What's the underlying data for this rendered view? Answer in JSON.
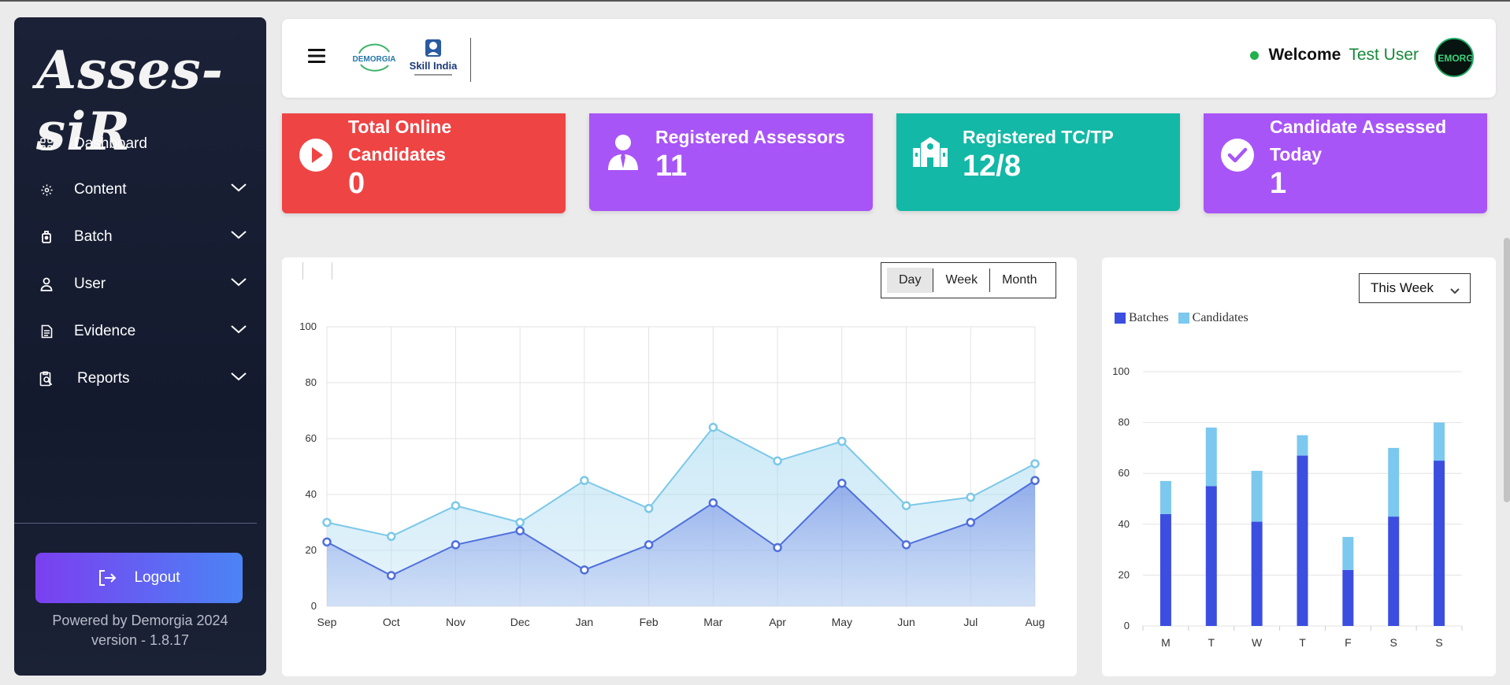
{
  "sidebar": {
    "logo_text": "Asses-siR",
    "items": [
      {
        "label": "Dashboard",
        "icon": "grid-icon"
      },
      {
        "label": "Content",
        "icon": "gear-icon"
      },
      {
        "label": "Batch",
        "icon": "batch-icon"
      },
      {
        "label": "User",
        "icon": "user-icon"
      },
      {
        "label": "Evidence",
        "icon": "document-icon"
      },
      {
        "label": "Reports",
        "icon": "report-icon"
      }
    ],
    "logout_label": "Logout",
    "powered_by": "Powered by Demorgia 2024",
    "version": "version - 1.8.17"
  },
  "header": {
    "demorgia_logo": "DEMORGIA",
    "skill_india_logo": "Skill India",
    "welcome_label": "Welcome",
    "user_name": "Test User",
    "avatar_text": "EMORG"
  },
  "stats": [
    {
      "title_line1": "Total Online",
      "title_line2": "Candidates",
      "value": "0",
      "color": "#ef4444",
      "icon": "play-circle-icon"
    },
    {
      "title_line1": "Registered Assessors",
      "title_line2": "",
      "value": "11",
      "color": "#a855f7",
      "icon": "assessor-icon"
    },
    {
      "title_line1": "Registered TC/TP",
      "title_line2": "",
      "value": "12/8",
      "color": "#14b8a6",
      "icon": "school-icon"
    },
    {
      "title_line1": "Candidate Assessed",
      "title_line2": "Today",
      "value": "1",
      "color": "#a855f7",
      "icon": "check-circle-icon"
    }
  ],
  "line_panel": {
    "ranges": [
      "Day",
      "Week",
      "Month"
    ],
    "active_range": "Day"
  },
  "bar_panel": {
    "select_value": "This Week"
  },
  "chart_data": [
    {
      "type": "area",
      "categories": [
        "Sep",
        "Oct",
        "Nov",
        "Dec",
        "Jan",
        "Feb",
        "Mar",
        "Apr",
        "May",
        "Jun",
        "Jul",
        "Aug"
      ],
      "series": [
        {
          "values": [
            30,
            25,
            36,
            30,
            45,
            35,
            64,
            52,
            59,
            36,
            39,
            51
          ],
          "color": "#7cc8e8"
        },
        {
          "values": [
            23,
            11,
            22,
            27,
            13,
            22,
            37,
            21,
            44,
            22,
            30,
            45
          ],
          "color": "#4f6fdc"
        }
      ],
      "ylim": [
        0,
        100
      ],
      "yticks": [
        0,
        20,
        40,
        60,
        80,
        100
      ],
      "grid": true
    },
    {
      "type": "bar",
      "stacked": true,
      "categories": [
        "M",
        "T",
        "W",
        "T",
        "F",
        "S",
        "S"
      ],
      "series": [
        {
          "name": "Batches",
          "values": [
            44,
            55,
            41,
            67,
            22,
            43,
            65
          ],
          "color": "#3b4ee0"
        },
        {
          "name": "Candidates",
          "values": [
            13,
            23,
            20,
            8,
            13,
            27,
            15
          ],
          "color": "#7cc8ee"
        }
      ],
      "ylim": [
        0,
        100
      ],
      "yticks": [
        0,
        20,
        40,
        60,
        80,
        100
      ],
      "legend": "top-left",
      "grid": true
    }
  ]
}
